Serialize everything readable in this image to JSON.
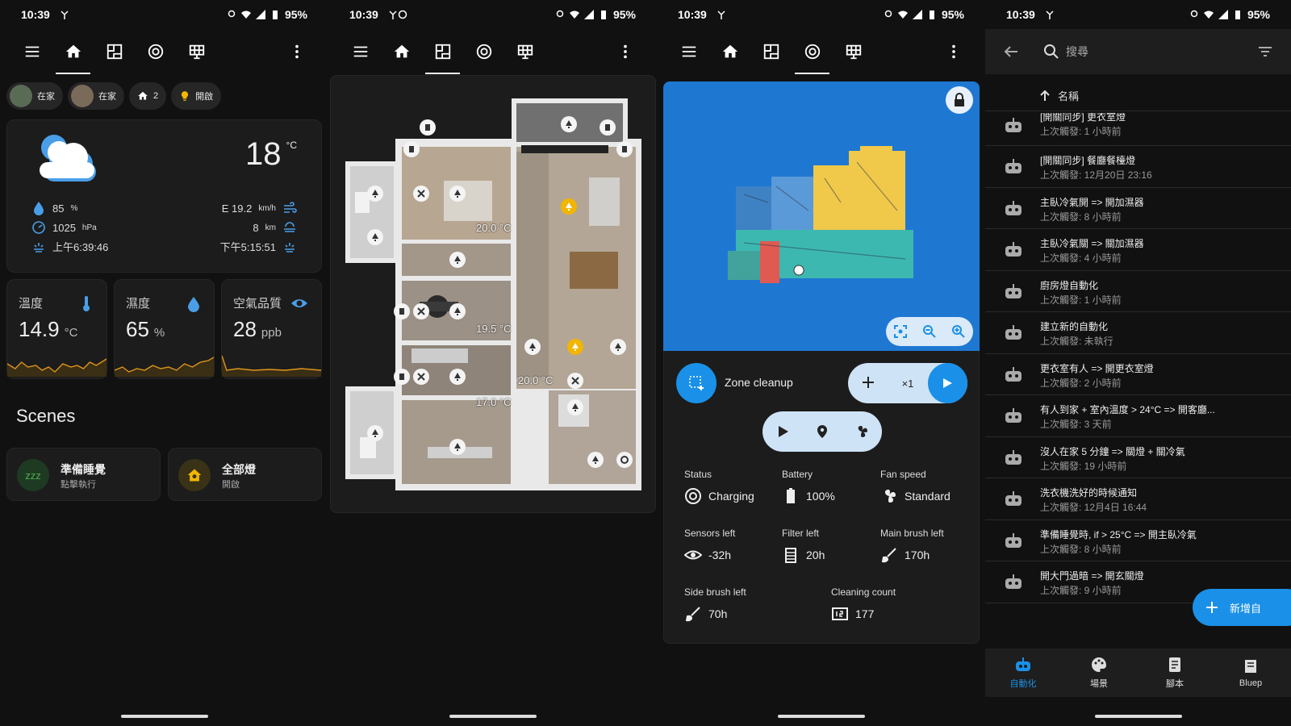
{
  "status_bar": [
    {
      "time": "10:39",
      "battery": "95%"
    },
    {
      "time": "10:39",
      "battery": "95%"
    },
    {
      "time": "10:39",
      "battery": "95%"
    },
    {
      "time": "10:39",
      "battery": "95%"
    }
  ],
  "dashboard": {
    "chips": [
      {
        "label": "在家"
      },
      {
        "label": "在家"
      },
      {
        "label": "2"
      },
      {
        "label": "開啟"
      }
    ],
    "weather": {
      "temperature": "18",
      "temp_unit": "°C",
      "humidity": "85",
      "humidity_unit": "%",
      "pressure": "1025",
      "pressure_unit": "hPa",
      "sunrise": "上午6:39:46",
      "wind": "E 19.2",
      "wind_unit": "km/h",
      "visibility": "8",
      "visibility_unit": "km",
      "sunset": "下午5:15:51"
    },
    "sensors": [
      {
        "label": "溫度",
        "value": "14.9",
        "unit": "°C"
      },
      {
        "label": "濕度",
        "value": "65",
        "unit": "%"
      },
      {
        "label": "空氣品質",
        "value": "28",
        "unit": "ppb"
      }
    ],
    "scenes_title": "Scenes",
    "scenes": [
      {
        "name": "準備睡覺",
        "sub": "點擊執行",
        "icon": "zzz"
      },
      {
        "name": "全部燈",
        "sub": "開啟"
      }
    ]
  },
  "floorplan": {
    "room_temps": [
      "20.0 °C",
      "19.5 °C",
      "20.0 °C",
      "17.0 °C"
    ]
  },
  "vacuum": {
    "zone_label": "Zone cleanup",
    "repeat_label": "×1",
    "stats": [
      {
        "label": "Status",
        "value": "Charging"
      },
      {
        "label": "Battery",
        "value": "100%"
      },
      {
        "label": "Fan speed",
        "value": "Standard"
      },
      {
        "label": "Sensors left",
        "value": "-32h"
      },
      {
        "label": "Filter left",
        "value": "20h"
      },
      {
        "label": "Main brush left",
        "value": "170h"
      },
      {
        "label": "Side brush left",
        "value": "70h"
      },
      {
        "label": "Cleaning count",
        "value": "177"
      }
    ]
  },
  "automations": {
    "search_placeholder": "搜尋",
    "sort_label": "名稱",
    "items": [
      {
        "name": "[開關同步] 更衣室燈",
        "time": "上次觸發: 1 小時前"
      },
      {
        "name": "[開關同步] 餐廳餐檯燈",
        "time": "上次觸發: 12月20日 23:16"
      },
      {
        "name": "主臥冷氣開 => 開加濕器",
        "time": "上次觸發: 8 小時前"
      },
      {
        "name": "主臥冷氣關 => 關加濕器",
        "time": "上次觸發: 4 小時前"
      },
      {
        "name": "廚房燈自動化",
        "time": "上次觸發: 1 小時前"
      },
      {
        "name": "建立新的自動化",
        "time": "上次觸發: 未執行"
      },
      {
        "name": "更衣室有人 => 開更衣室燈",
        "time": "上次觸發: 2 小時前"
      },
      {
        "name": "有人到家 + 室內溫度 > 24°C => 開客廳...",
        "time": "上次觸發: 3 天前"
      },
      {
        "name": "沒人在家 5 分鐘 => 關燈 + 關冷氣",
        "time": "上次觸發: 19 小時前"
      },
      {
        "name": "洗衣機洗好的時候通知",
        "time": "上次觸發: 12月4日 16:44"
      },
      {
        "name": "準備睡覺時, if > 25°C => 開主臥冷氣",
        "time": "上次觸發: 8 小時前"
      },
      {
        "name": "開大門過暗 => 開玄關燈",
        "time": "上次觸發: 9 小時前"
      }
    ],
    "fab_label": "新增自",
    "nav": [
      {
        "label": "自動化"
      },
      {
        "label": "場景"
      },
      {
        "label": "腳本"
      },
      {
        "label": "Bluep"
      }
    ]
  },
  "colors": {
    "accent": "#1a90e8",
    "bulb_on": "#f2b600",
    "map_bg": "#1e78d2"
  }
}
